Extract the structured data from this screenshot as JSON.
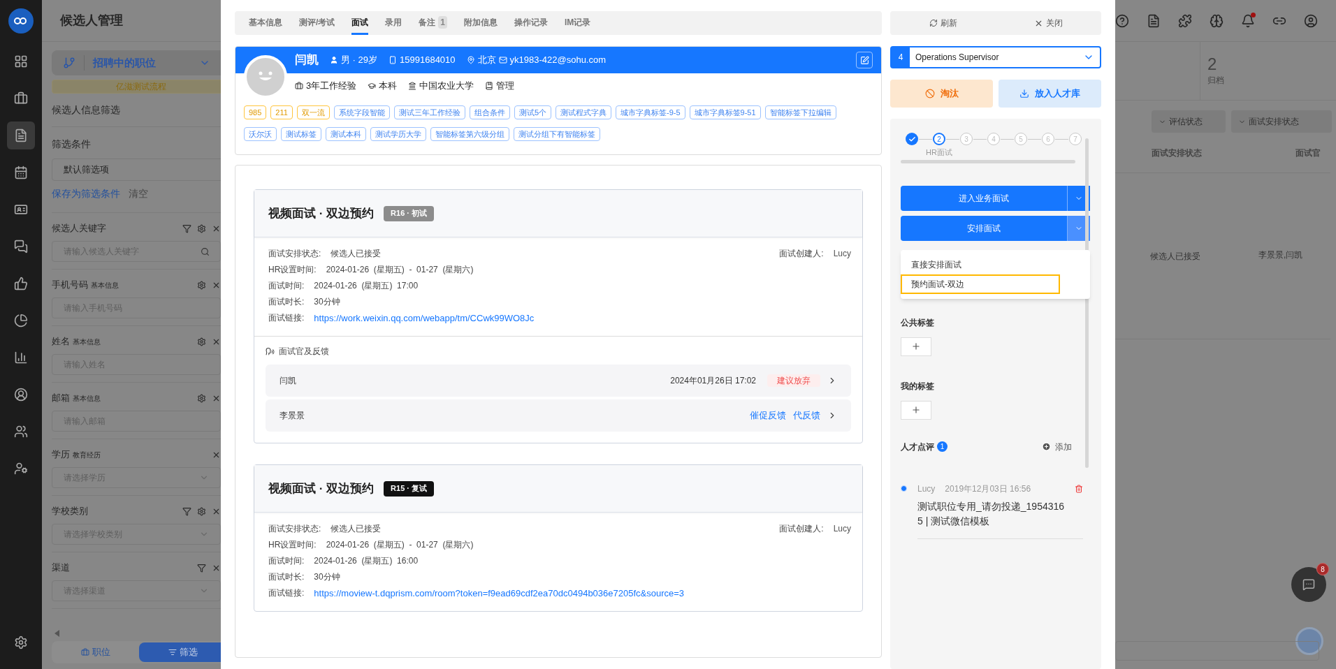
{
  "nav_items": [
    {
      "selected": false
    },
    {
      "selected": false
    },
    {
      "selected": true
    },
    {
      "selected": false
    },
    {
      "selected": false
    },
    {
      "selected": false
    },
    {
      "selected": false
    },
    {
      "selected": false
    },
    {
      "selected": false
    },
    {
      "selected": false
    },
    {
      "selected": false
    },
    {
      "selected": false
    }
  ],
  "page_title": "候选人管理",
  "filter_panel": {
    "position_select": "招聘中的职位",
    "process_banner": "亿滋测试流程",
    "section_title": "候选人信息筛选",
    "conditions_label": "筛选条件",
    "conditions_value": "默认筛选项",
    "save_link": "保存为筛选条件",
    "clear_link": "清空",
    "fields": [
      {
        "label": "候选人关键字",
        "kind": "search",
        "placeholder": "请输入候选人关键字",
        "tools": [
          {
            "kind": "filter"
          },
          {
            "kind": "settings"
          },
          {
            "kind": "close"
          }
        ]
      },
      {
        "label": "手机号码",
        "sub": "基本信息",
        "kind": "text",
        "placeholder": "请输入手机号码",
        "tools": [
          {
            "kind": "settings"
          },
          {
            "kind": "close"
          }
        ]
      },
      {
        "label": "姓名",
        "sub": "基本信息",
        "kind": "text",
        "placeholder": "请输入姓名",
        "tools": [
          {
            "kind": "settings"
          },
          {
            "kind": "close"
          }
        ]
      },
      {
        "label": "邮箱",
        "sub": "基本信息",
        "kind": "text",
        "placeholder": "请输入邮箱",
        "tools": [
          {
            "kind": "settings"
          },
          {
            "kind": "close"
          }
        ]
      },
      {
        "label": "学历",
        "sub": "教育经历",
        "kind": "select",
        "placeholder": "请选择学历",
        "tools": [
          {
            "kind": "close"
          }
        ]
      },
      {
        "label": "学校类别",
        "kind": "select",
        "placeholder": "请选择学校类别",
        "tools": [
          {
            "kind": "filter"
          },
          {
            "kind": "settings"
          },
          {
            "kind": "close"
          }
        ]
      },
      {
        "label": "渠道",
        "kind": "select",
        "placeholder": "请选择渠道",
        "tools": [
          {
            "kind": "filter"
          },
          {
            "kind": "close"
          }
        ]
      }
    ],
    "bottom_tabs": [
      {
        "label": "职位",
        "selected": false
      },
      {
        "label": "筛选",
        "selected": true
      }
    ]
  },
  "tabs": [
    {
      "label": "基本信息",
      "selected": false
    },
    {
      "label": "测评/考试",
      "selected": false
    },
    {
      "label": "面试",
      "selected": true
    },
    {
      "label": "录用",
      "selected": false
    },
    {
      "label": "备注",
      "badge": "1",
      "selected": false
    },
    {
      "label": "附加信息",
      "selected": false
    },
    {
      "label": "操作记录",
      "selected": false
    },
    {
      "label": "IM记录",
      "selected": false
    }
  ],
  "profile": {
    "name": "闫凯",
    "gender_age": "男 · 29岁",
    "phone": "15991684010",
    "city": "北京",
    "email": "yk1983-422@sohu.com",
    "facts": [
      {
        "kind": "experience",
        "text": "3年工作经验"
      },
      {
        "kind": "degree",
        "text": "本科"
      },
      {
        "kind": "school",
        "text": "中国农业大学"
      },
      {
        "kind": "major",
        "text": "管理"
      }
    ],
    "tags": [
      {
        "text": "985",
        "kind": "highlight"
      },
      {
        "text": "211",
        "kind": "highlight"
      },
      {
        "text": "双一流",
        "kind": "highlight"
      },
      {
        "text": "系统字段智能",
        "kind": "normal"
      },
      {
        "text": "测试三年工作经验",
        "kind": "normal"
      },
      {
        "text": "组合条件",
        "kind": "normal"
      },
      {
        "text": "测试5个",
        "kind": "normal"
      },
      {
        "text": "测试程式字典",
        "kind": "normal"
      },
      {
        "text": "城市字典标签-9-5",
        "kind": "normal"
      },
      {
        "text": "城市字典标签9-51",
        "kind": "normal"
      },
      {
        "text": "智能标签下拉编辑",
        "kind": "normal"
      },
      {
        "text": "沃尔沃",
        "kind": "normal"
      },
      {
        "text": "测试标签",
        "kind": "normal"
      },
      {
        "text": "测试本科",
        "kind": "normal"
      },
      {
        "text": "测试学历大学",
        "kind": "normal"
      },
      {
        "text": "智能标签第六级分组",
        "kind": "normal"
      },
      {
        "text": "测试分组下有智能标签",
        "kind": "normal"
      }
    ]
  },
  "interviews": [
    {
      "title": "视频面试 · 双边预约",
      "badge": {
        "text": "R16 · 初试",
        "color": "#8c8c8c"
      },
      "creator_label": "面试创建人:",
      "creator": "Lucy",
      "rows": [
        {
          "label": "面试安排状态:",
          "value": "候选人已接受",
          "kind": "text"
        },
        {
          "label": "HR设置时间:",
          "value": "2024-01-26  (星期五)  -  01-27  (星期六)",
          "kind": "text"
        },
        {
          "label": "面试时间:",
          "value": "2024-01-26  (星期五)  17:00",
          "kind": "text"
        },
        {
          "label": "面试时长:",
          "value": "30分钟",
          "kind": "text"
        },
        {
          "label": "面试链接:",
          "value": "https://work.weixin.qq.com/webapp/tm/CCwk99WO8Jc",
          "kind": "link"
        }
      ],
      "feedback": {
        "title": "面试官及反馈",
        "rows": [
          {
            "name": "闫凯",
            "time": "2024年01月26日 17:02",
            "status": "建议放弃"
          },
          {
            "name": "李景景",
            "actions": [
              "催促反馈",
              "代反馈"
            ]
          }
        ]
      }
    },
    {
      "title": "视频面试 · 双边预约",
      "badge": {
        "text": "R15 · 复试",
        "color": "#111111"
      },
      "creator_label": "面试创建人:",
      "creator": "Lucy",
      "rows": [
        {
          "label": "面试安排状态:",
          "value": "候选人已接受",
          "kind": "text"
        },
        {
          "label": "HR设置时间:",
          "value": "2024-01-26  (星期五)  -  01-27  (星期六)",
          "kind": "text"
        },
        {
          "label": "面试时间:",
          "value": "2024-01-26  (星期五)  16:00",
          "kind": "text"
        },
        {
          "label": "面试时长:",
          "value": "30分钟",
          "kind": "text"
        },
        {
          "label": "面试链接:",
          "value": "https://moview-t.dqprism.com/room?token=f9ead69cdf2ea70dc0494b036e7205fc&source=3",
          "kind": "link"
        }
      ]
    }
  ],
  "side": {
    "refresh": "刷新",
    "close": "关闭",
    "job_number": "4",
    "job": "Operations Supervisor",
    "reject": "淘汰",
    "talent_pool": "放入人才库",
    "steps": [
      {
        "done": true,
        "current": false
      },
      {
        "number": "2",
        "done": false,
        "current": true,
        "label": "HR面试"
      },
      {
        "number": "3",
        "done": false,
        "current": false
      },
      {
        "number": "4",
        "done": false,
        "current": false
      },
      {
        "number": "5",
        "done": false,
        "current": false
      },
      {
        "number": "6",
        "done": false,
        "current": false
      },
      {
        "number": "7",
        "done": false,
        "current": false
      }
    ],
    "primary_actions": [
      {
        "label": "进入业务面试",
        "expanded": false
      },
      {
        "label": "安排面试",
        "expanded": true
      }
    ],
    "menu": [
      {
        "label": "直接安排面试",
        "selected": false
      },
      {
        "label": "预约面试-双边",
        "selected": true
      }
    ],
    "public_tags": "公共标签",
    "my_tags": "我的标签",
    "review_title": "人才点评",
    "review_count": "1",
    "add": "添加",
    "comments": [
      {
        "author": "Lucy",
        "time": "2019年12月03日 16:56",
        "text": "测试职位专用_请勿投递_19543165 | 测试微信模板"
      }
    ]
  },
  "background": {
    "stat_value": "2",
    "stat_label": "归档",
    "filters": [
      "评估状态",
      "面试安排状态"
    ],
    "columns": [
      "面试安排状态",
      "面试官"
    ],
    "row": [
      "候选人已接受",
      "李景景,闫凯"
    ],
    "chat_badge": "8"
  }
}
